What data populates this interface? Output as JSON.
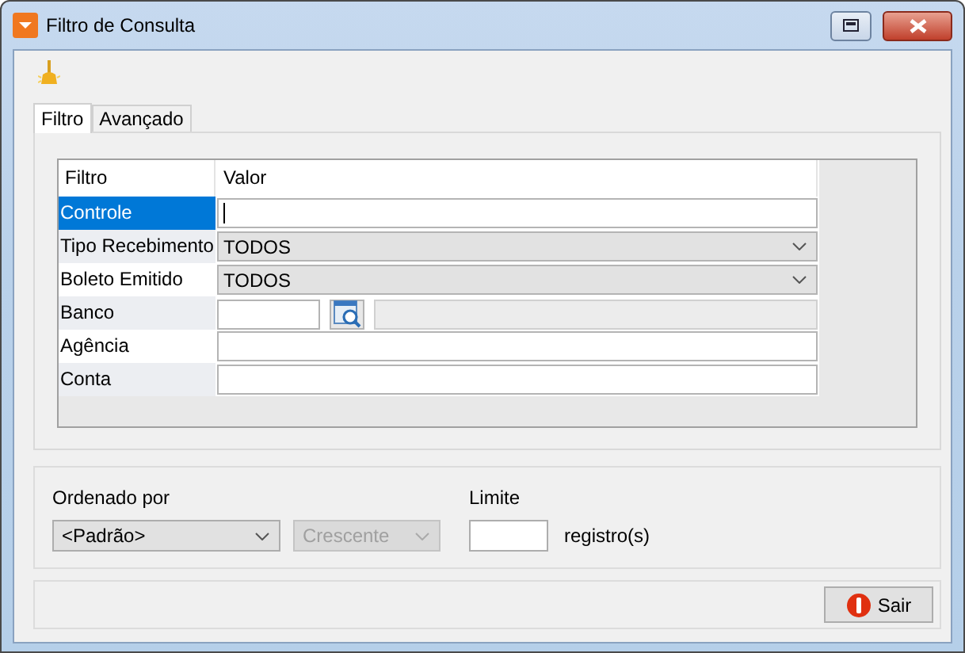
{
  "window": {
    "title": "Filtro de Consulta"
  },
  "tabs": [
    {
      "label": "Filtro",
      "selected": true
    },
    {
      "label": "Avançado",
      "selected": false
    }
  ],
  "grid": {
    "columns": [
      "Filtro",
      "Valor"
    ],
    "rows": [
      {
        "label": "Controle",
        "kind": "text",
        "selected": true
      },
      {
        "label": "Tipo Recebimento",
        "kind": "combo",
        "value": "TODOS",
        "selected": false
      },
      {
        "label": "Boleto Emitido",
        "kind": "combo",
        "value": "TODOS",
        "selected": false
      },
      {
        "label": "Banco",
        "kind": "lookup",
        "selected": false
      },
      {
        "label": "Agência",
        "kind": "text",
        "selected": false
      },
      {
        "label": "Conta",
        "kind": "text",
        "selected": false
      }
    ]
  },
  "order": {
    "label": "Ordenado por",
    "field": "<Padrão>",
    "direction": "Crescente",
    "direction_disabled": true
  },
  "limit": {
    "label": "Limite",
    "unit": "registro(s)"
  },
  "buttons": [
    {
      "label": "Sair"
    }
  ]
}
